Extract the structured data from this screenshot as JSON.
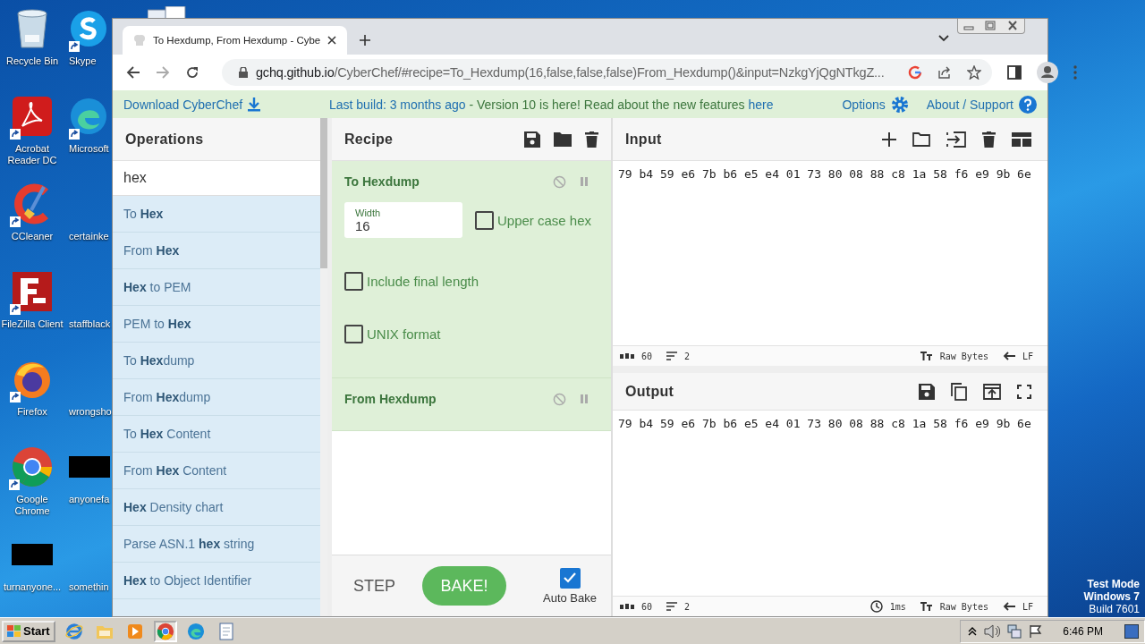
{
  "desktop_icons": [
    {
      "label": "Recycle Bin",
      "kind": "recycle-bin",
      "shortcut": false
    },
    {
      "label": "Skype",
      "kind": "skype",
      "shortcut": true
    },
    {
      "label": "Acrobat Reader DC",
      "kind": "acrobat",
      "shortcut": true
    },
    {
      "label": "Microsoft",
      "kind": "edge",
      "shortcut": true
    },
    {
      "label": "CCleaner",
      "kind": "ccleaner",
      "shortcut": true
    },
    {
      "label": "certainke",
      "kind": "none",
      "shortcut": false
    },
    {
      "label": "FileZilla Client",
      "kind": "filezilla",
      "shortcut": true
    },
    {
      "label": "staffblack",
      "kind": "none",
      "shortcut": false
    },
    {
      "label": "Firefox",
      "kind": "firefox",
      "shortcut": true
    },
    {
      "label": "wrongsho",
      "kind": "none",
      "shortcut": false
    },
    {
      "label": "Google Chrome",
      "kind": "chrome",
      "shortcut": true
    },
    {
      "label": "anyonefa",
      "kind": "black",
      "shortcut": false
    },
    {
      "label": "turnanyone...",
      "kind": "black",
      "shortcut": false
    },
    {
      "label": "somethin",
      "kind": "none",
      "shortcut": false
    }
  ],
  "browser": {
    "tab_title": "To Hexdump, From Hexdump - Cybe",
    "url_host": "gchq.github.io",
    "url_rest": "/CyberChef/#recipe=To_Hexdump(16,false,false,false)From_Hexdump()&input=NzkgYjQgNTkgZ..."
  },
  "banner": {
    "download": "Download CyberChef",
    "build_link": "Last build: 3 months ago",
    "message": " - Version 10 is here! Read about the new features ",
    "here_link": "here",
    "options": "Options",
    "about": "About / Support"
  },
  "operations": {
    "title": "Operations",
    "search": {
      "value": "hex"
    },
    "items": [
      "To **Hex**",
      "From **Hex**",
      "**Hex** to PEM",
      "PEM to **Hex**",
      "To **Hex**dump",
      "From **Hex**dump",
      "To **Hex** Content",
      "From **Hex** Content",
      "**Hex** Density chart",
      "Parse ASN.1 **hex** string",
      "**Hex** to Object Identifier"
    ]
  },
  "recipe": {
    "title": "Recipe",
    "ops": [
      {
        "name": "To Hexdump",
        "disabled": false,
        "breakpoint": false,
        "args": [
          {
            "kind": "number",
            "label": "Width",
            "value": "16"
          },
          {
            "kind": "checkbox",
            "label": "Upper case hex",
            "checked": false
          },
          {
            "kind": "checkbox",
            "label": "Include final length",
            "checked": false
          },
          {
            "kind": "checkbox",
            "label": "UNIX format",
            "checked": false
          }
        ]
      },
      {
        "name": "From Hexdump",
        "disabled": false,
        "breakpoint": false
      }
    ],
    "step": "STEP",
    "bake": "BAKE!",
    "auto_bake": {
      "label": "Auto Bake",
      "checked": true
    }
  },
  "input": {
    "title": "Input",
    "text": "79 b4 59 e6 7b b6 e5 e4 01 73 80 08 88 c8 1a 58 f6 e9 9b 6e",
    "chars": "60",
    "lines": "2",
    "encoding": "Raw Bytes",
    "eol": "LF"
  },
  "output": {
    "title": "Output",
    "text": "79 b4 59 e6 7b b6 e5 e4 01 73 80 08 88 c8 1a 58 f6 e9 9b 6e",
    "chars": "60",
    "lines": "2",
    "time": "1ms",
    "encoding": "Raw Bytes",
    "eol": "LF"
  },
  "os_notice": [
    "Test Mode",
    "Windows 7",
    "Build 7601"
  ],
  "taskbar": {
    "start": "Start",
    "apps": [
      {
        "kind": "ie",
        "active": false
      },
      {
        "kind": "explorer",
        "active": false
      },
      {
        "kind": "media",
        "active": false
      },
      {
        "kind": "chrome",
        "active": true
      },
      {
        "kind": "edge",
        "active": false
      },
      {
        "kind": "notepad",
        "active": false
      }
    ],
    "clock": "6:46 PM"
  }
}
